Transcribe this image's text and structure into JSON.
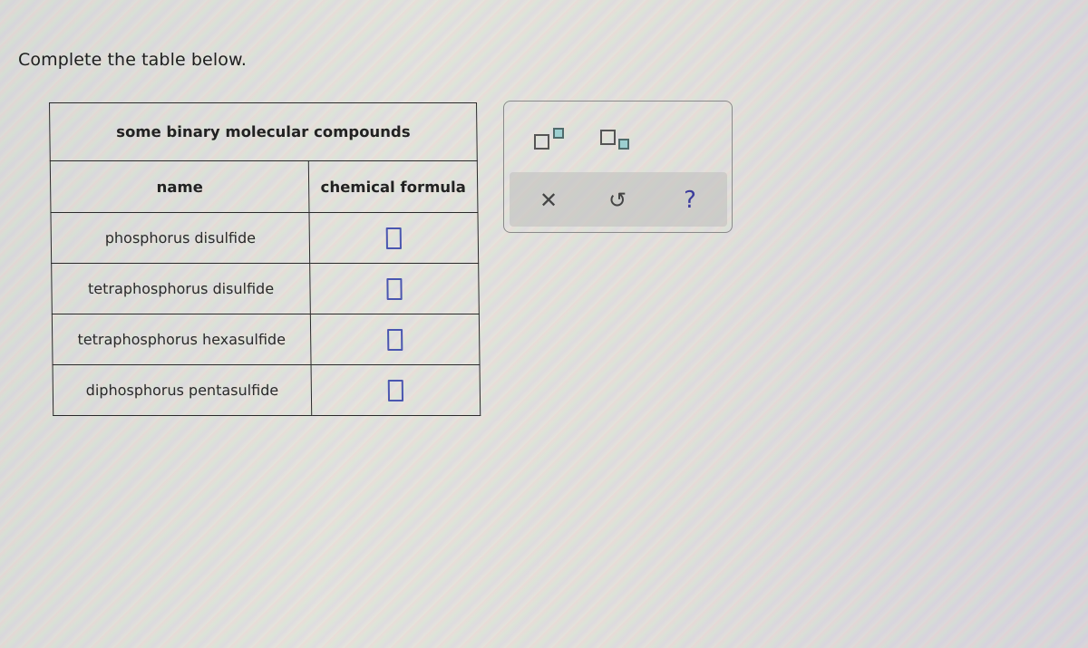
{
  "prompt": "Complete the table below.",
  "table": {
    "caption": "some binary molecular compounds",
    "headers": {
      "name": "name",
      "formula": "chemical formula"
    },
    "rows": [
      {
        "name": "phosphorus disulfide",
        "formula": ""
      },
      {
        "name": "tetraphosphorus disulfide",
        "formula": ""
      },
      {
        "name": "tetraphosphorus hexasulfide",
        "formula": ""
      },
      {
        "name": "diphosphorus pentasulfide",
        "formula": ""
      }
    ]
  },
  "toolbar": {
    "tools": [
      {
        "icon": "superscript-icon",
        "label": "superscript"
      },
      {
        "icon": "subscript-icon",
        "label": "subscript"
      }
    ],
    "actions": [
      {
        "icon": "close-icon",
        "glyph": "✕",
        "label": "clear"
      },
      {
        "icon": "undo-icon",
        "glyph": "↺",
        "label": "undo"
      },
      {
        "icon": "help-icon",
        "glyph": "?",
        "label": "help"
      }
    ]
  },
  "colors": {
    "answer_box_border": "#4a56b0",
    "subscript_fill": "#9ccfd0",
    "help_icon": "#3c3c9c"
  }
}
